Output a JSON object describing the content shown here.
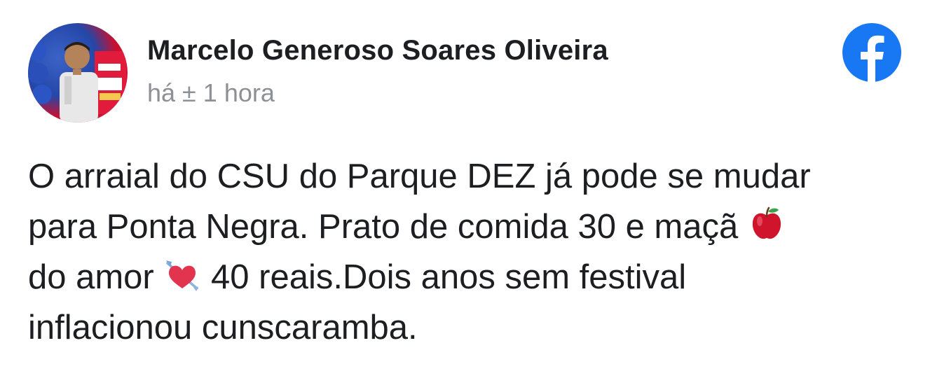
{
  "post": {
    "author": "Marcelo Generoso Soares Oliveira",
    "timestamp": "há ± 1 hora",
    "platform_icon": "facebook-icon",
    "avatar_icon": "profile-photo",
    "lines": [
      {
        "text": "O arraial do CSU do Parque DEZ já pode se mudar"
      },
      {
        "text_before": "para Ponta Negra. Prato de comida 30 e maçã",
        "emoji": "red-apple-emoji"
      },
      {
        "text_before": "do amor",
        "emoji": "heart-with-arrow-emoji",
        "text_after": "40 reais.Dois anos sem festival"
      },
      {
        "text": "inflacionou cunscaramba."
      }
    ]
  },
  "colors": {
    "facebook_blue": "#1877f2",
    "text": "#1c1e21",
    "muted": "#8d9095"
  }
}
